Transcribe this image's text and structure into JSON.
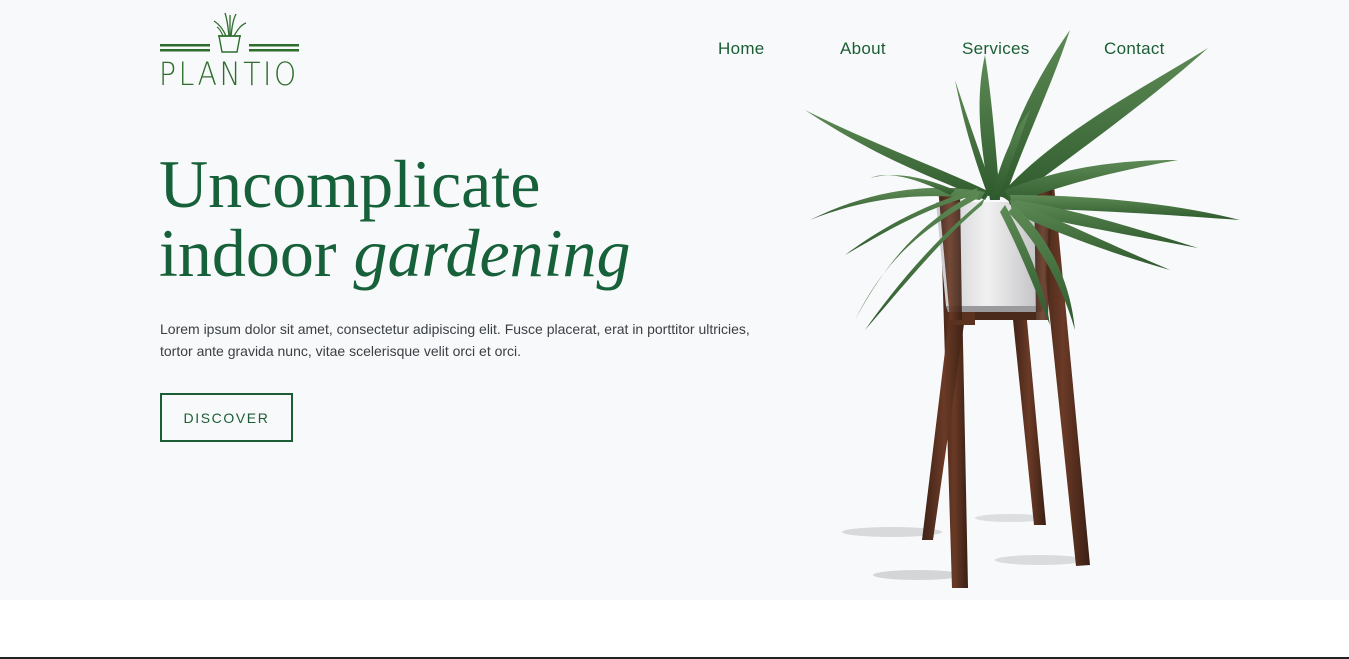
{
  "brand": {
    "name": "PLANTIO",
    "color": "#2e6d2c"
  },
  "nav": {
    "items": [
      "Home",
      "About",
      "Services",
      "Contact"
    ]
  },
  "hero": {
    "title_line1": "Uncomplicate",
    "title_line2_plain": "indoor",
    "title_line2_italic": "gardening",
    "description": "Lorem ipsum dolor sit amet, consectetur adipiscing elit. Fusce placerat, erat in porttitor ultricies, tortor ante gravida nunc, vitae scelerisque velit orci et orci.",
    "cta_label": "DISCOVER"
  },
  "colors": {
    "primary": "#1b5e35",
    "hero_background": "#f8f9fa",
    "text": "#3a3f44"
  },
  "icons": {
    "logo": "potted-plant-icon",
    "hero_image": "aloe-plant-on-wooden-stand"
  }
}
